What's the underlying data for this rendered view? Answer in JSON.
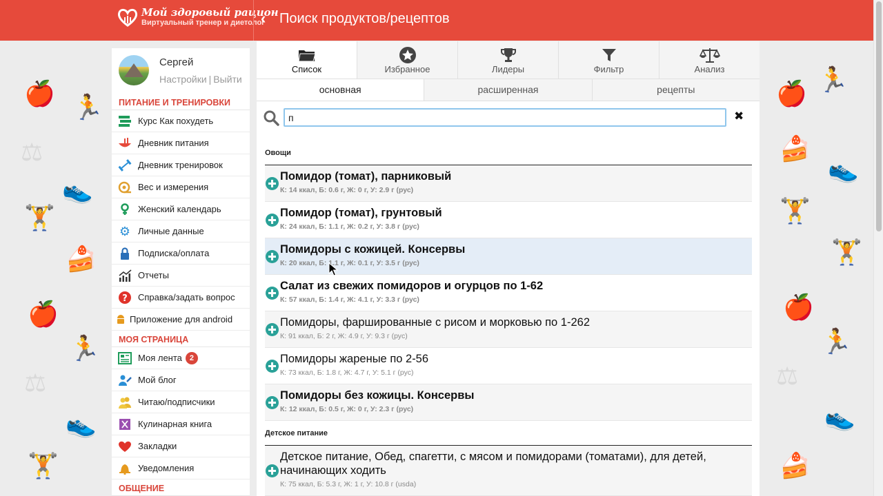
{
  "header": {
    "logo_title": "Мой здоровый рацион",
    "logo_subtitle": "Виртуальный тренер и диетолог",
    "back_label": "‹",
    "title": "Поиск продуктов/рецептов",
    "accent_color": "#e64a3b"
  },
  "user": {
    "name": "Сергей",
    "settings_link": "Настройки",
    "separator": "|",
    "logout_link": "Выйти"
  },
  "sidebar": {
    "section1_title": "ПИТАНИЕ И ТРЕНИРОВКИ",
    "section1_items": [
      {
        "label": "Курс Как похудеть",
        "icon": "course-icon"
      },
      {
        "label": "Дневник питания",
        "icon": "food-diary-icon"
      },
      {
        "label": "Дневник тренировок",
        "icon": "dumbbell-icon"
      },
      {
        "label": "Вес и измерения",
        "icon": "measure-tape-icon"
      },
      {
        "label": "Женский календарь",
        "icon": "female-icon"
      },
      {
        "label": "Личные данные",
        "icon": "gear-icon"
      },
      {
        "label": "Подписка/оплата",
        "icon": "lock-icon"
      },
      {
        "label": "Отчеты",
        "icon": "chart-icon"
      },
      {
        "label": "Справка/задать вопрос",
        "icon": "help-icon"
      },
      {
        "label": "Приложение для android",
        "icon": "android-icon"
      }
    ],
    "section2_title": "МОЯ СТРАНИЦА",
    "section2_items": [
      {
        "label": "Моя лента",
        "icon": "feed-icon",
        "badge": "2"
      },
      {
        "label": "Мой блог",
        "icon": "blog-icon"
      },
      {
        "label": "Читаю/подписчики",
        "icon": "users-icon"
      },
      {
        "label": "Кулинарная книга",
        "icon": "cookbook-icon"
      },
      {
        "label": "Закладки",
        "icon": "heart-icon"
      },
      {
        "label": "Уведомления",
        "icon": "bell-icon"
      }
    ],
    "section3_title": "ОБЩЕНИЕ"
  },
  "tabs_top": [
    {
      "label": "Список",
      "icon": "folder-icon"
    },
    {
      "label": "Избранное",
      "icon": "star-icon"
    },
    {
      "label": "Лидеры",
      "icon": "trophy-icon"
    },
    {
      "label": "Фильтр",
      "icon": "filter-icon"
    },
    {
      "label": "Анализ",
      "icon": "scales-icon"
    }
  ],
  "tabs_sub": [
    {
      "label": "основная"
    },
    {
      "label": "расширенная"
    },
    {
      "label": "рецепты"
    }
  ],
  "search": {
    "value": "п",
    "clear_label": "✖"
  },
  "groups": [
    {
      "title": "Овощи",
      "items": [
        {
          "name": "Помидор (томат), парниковый",
          "info": "К: 14 ккал, Б: 0.6 г, Ж: 0 г, У: 2.9 г (рус)"
        },
        {
          "name": "Помидор (томат), грунтовый",
          "info": "К: 24 ккал, Б: 1.1 г, Ж: 0.2 г, У: 3.8 г (рус)"
        },
        {
          "name": "Помидоры с кожицей. Консервы",
          "info": "К: 20 ккал, Б: 1.1 г, Ж: 0.1 г, У: 3.5 г (рус)"
        },
        {
          "name": "Салат из свежих помидоров и огурцов по 1-62",
          "info": "К: 57 ккал, Б: 1.4 г, Ж: 4.1 г, У: 3.3 г (рус)"
        },
        {
          "name": "Помидоры, фаршированные с рисом и морковью по 1-262",
          "info": "К: 91 ккал, Б: 2 г, Ж: 4.9 г, У: 9.3 г (рус)"
        },
        {
          "name": "Помидоры жареные по 2-56",
          "info": "К: 73 ккал, Б: 1.8 г, Ж: 4.7 г, У: 5.1 г (рус)"
        },
        {
          "name": "Помидоры без кожицы. Консервы",
          "info": "К: 12 ккал, Б: 0.5 г, Ж: 0 г, У: 2.3 г (рус)"
        }
      ]
    },
    {
      "title": "Детское питание",
      "items": [
        {
          "name": "Детское питание, Обед, спагетти, с мясом и помидорами (томатами), для детей, начинающих ходить",
          "info": "К: 75 ккал, Б: 5.3 г, Ж: 1 г, У: 10.8 г (usda)"
        }
      ]
    }
  ]
}
